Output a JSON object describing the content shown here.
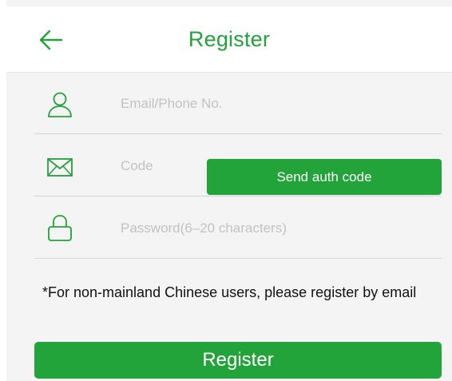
{
  "header": {
    "title": "Register",
    "back_icon": "arrow-left-icon"
  },
  "form": {
    "email": {
      "placeholder": "Email/Phone No.",
      "value": "",
      "icon": "user-icon"
    },
    "code": {
      "placeholder": "Code",
      "value": "",
      "icon": "envelope-icon",
      "send_label": "Send auth code"
    },
    "password": {
      "placeholder": "Password(6–20 characters)",
      "value": "",
      "icon": "lock-icon"
    }
  },
  "notice": "*For non-mainland Chinese users, please register by email",
  "register_label": "Register",
  "colors": {
    "accent": "#22a43a",
    "background": "#f4f4f4",
    "header_bg": "#ffffff"
  }
}
